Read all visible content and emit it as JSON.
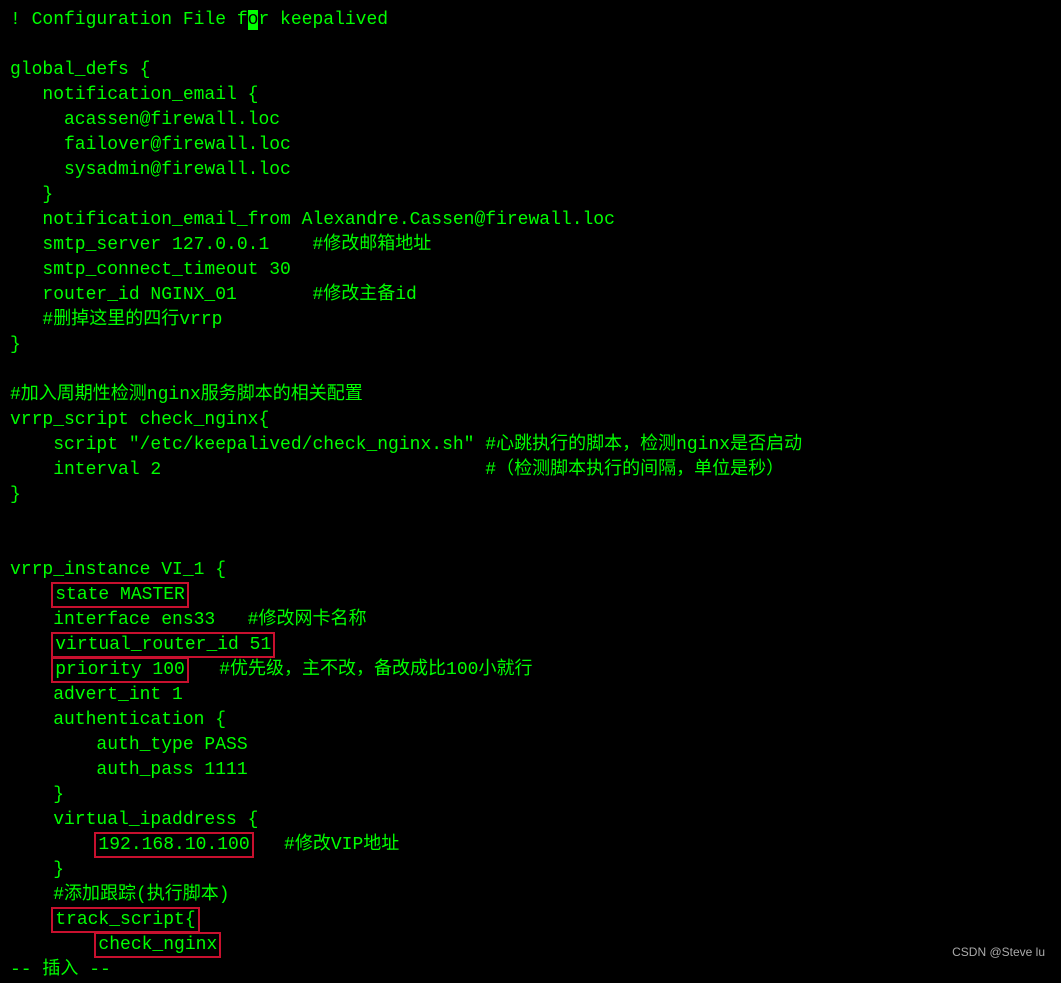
{
  "header": {
    "comment": "! Configuration File f",
    "cursor_char": "o",
    "rest": "r keepalived"
  },
  "global_defs": {
    "open": "global_defs {",
    "notif_open": "   notification_email {",
    "emails": [
      "     acassen@firewall.loc",
      "     failover@firewall.loc",
      "     sysadmin@firewall.loc"
    ],
    "notif_close": "   }",
    "from": "   notification_email_from Alexandre.Cassen@firewall.loc",
    "smtp_server": "   smtp_server 127.0.0.1    #修改邮箱地址",
    "smtp_timeout": "   smtp_connect_timeout 30",
    "router_id": "   router_id NGINX_01       #修改主备id",
    "del_comment": "   #删掉这里的四行vrrp",
    "close": "}"
  },
  "script_block": {
    "comment": "#加入周期性检测nginx服务脚本的相关配置",
    "open": "vrrp_script check_nginx{",
    "script_line": "    script \"/etc/keepalived/check_nginx.sh\" #心跳执行的脚本，检测nginx是否启动",
    "interval_line": "    interval 2                              #（检测脚本执行的间隔，单位是秒）",
    "close": "}"
  },
  "instance": {
    "open": "vrrp_instance VI_1 {",
    "state_pad": "    ",
    "state": "state MASTER",
    "interface": "    interface ens33   #修改网卡名称",
    "vrid_pad": "    ",
    "vrid": "virtual_router_id 51",
    "prio_pad": "    ",
    "prio": "priority 100",
    "prio_after": "   #优先级，主不改，备改成比100小就行",
    "advert": "    advert_int 1",
    "auth_open": "    authentication {",
    "auth_type": "        auth_type PASS",
    "auth_pass": "        auth_pass 1111",
    "auth_close": "    }",
    "vip_open": "    virtual_ipaddress {",
    "vip_pad": "        ",
    "vip": "192.168.10.100",
    "vip_after": "   #修改VIP地址",
    "vip_close": "    }",
    "track_comment": "    #添加跟踪(执行脚本)",
    "track_pad": "    ",
    "track_open": "track_script{",
    "track_inner_pad": "        ",
    "track_inner": "check_nginx"
  },
  "status": "-- 插入 --",
  "watermark": "CSDN @Steve lu"
}
